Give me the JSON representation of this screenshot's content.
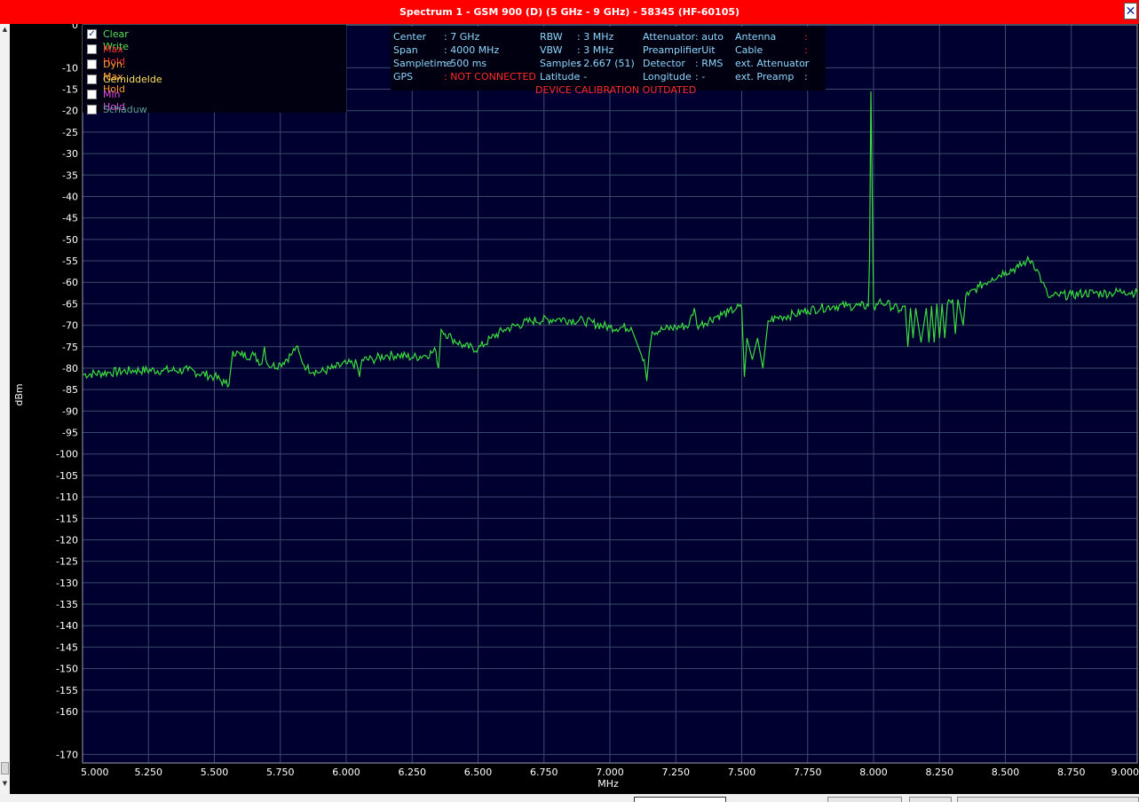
{
  "window": {
    "title": "Spectrum 1 - GSM 900 (D) (5 GHz - 9 GHz) - 58345 (HF-60105)",
    "close_glyph": "✕"
  },
  "colors": {
    "title_bar": "#ff0000",
    "plot_bg": "#000030",
    "grid": "#3a4a6a",
    "trace": "#3cdc3c",
    "axis_text": "#ffffff",
    "info_text": "#8fd7ff",
    "warning_text": "#ff2a2a"
  },
  "legend": [
    {
      "label": "Clear Write",
      "checked": true,
      "color": "#55e055"
    },
    {
      "label": "Max Hold",
      "checked": false,
      "color": "#ff3030"
    },
    {
      "label": "Dyn. Max Hold",
      "checked": false,
      "color": "#ff9a30"
    },
    {
      "label": "Gemiddelde",
      "checked": false,
      "color": "#ffe060"
    },
    {
      "label": "Min Hold",
      "checked": false,
      "color": "#e050e0"
    },
    {
      "label": "Schaduw",
      "checked": false,
      "color": "#5aa0a0"
    }
  ],
  "info": {
    "center_label": "Center",
    "center_value": ": 7 GHz",
    "span_label": "Span",
    "span_value": ": 4000 MHz",
    "sampletime_label": "Sampletime",
    "sampletime_value": ": 500 ms",
    "gps_label": "GPS",
    "gps_value": ": NOT CONNECTED",
    "rbw_label": "RBW",
    "rbw_value": ": 3 MHz",
    "vbw_label": "VBW",
    "vbw_value": ": 3 MHz",
    "samples_label": "Samples",
    "samples_value": ": 2.667 (51)",
    "latitude_label": "Latitude",
    "latitude_value": ": -",
    "attenuator_label": "Attenuator",
    "attenuator_value": ": auto",
    "preamp_label": "Preamplifier",
    "preamp_value": ": Uit",
    "detector_label": "Detector",
    "detector_value": ": RMS",
    "longitude_label": "Longitude",
    "longitude_value": ": -",
    "antenna_label": "Antenna",
    "antenna_value": ":",
    "cable_label": "Cable",
    "cable_value": ":",
    "ext_att_label": "ext. Attenuator",
    "ext_att_value": ":",
    "ext_preamp_label": "ext. Preamp",
    "ext_preamp_value": ":",
    "warning": "DEVICE CALIBRATION OUTDATED"
  },
  "chart_data": {
    "type": "line",
    "xlabel": "MHz",
    "ylabel": "dBm",
    "xlim": [
      5000,
      9000
    ],
    "ylim": [
      -172,
      0
    ],
    "grid": true,
    "x_ticks": [
      "5.000",
      "5.250",
      "5.500",
      "5.750",
      "6.000",
      "6.250",
      "6.500",
      "6.750",
      "7.000",
      "7.250",
      "7.500",
      "7.750",
      "8.000",
      "8.250",
      "8.500",
      "8.750",
      "9.000"
    ],
    "y_ticks": [
      "0",
      "-10",
      "-15",
      "-20",
      "-25",
      "-30",
      "-35",
      "-40",
      "-45",
      "-50",
      "-55",
      "-60",
      "-65",
      "-70",
      "-75",
      "-80",
      "-85",
      "-90",
      "-95",
      "-100",
      "-105",
      "-110",
      "-115",
      "-120",
      "-125",
      "-130",
      "-135",
      "-140",
      "-145",
      "-150",
      "-155",
      "-160",
      "-170"
    ],
    "series": [
      {
        "name": "Clear Write",
        "x": [
          5000,
          5100,
          5200,
          5300,
          5400,
          5500,
          5540,
          5555,
          5570,
          5600,
          5650,
          5680,
          5690,
          5700,
          5720,
          5750,
          5790,
          5810,
          5830,
          5850,
          5900,
          5950,
          6000,
          6040,
          6050,
          6060,
          6100,
          6150,
          6200,
          6250,
          6300,
          6340,
          6350,
          6360,
          6400,
          6450,
          6500,
          6550,
          6600,
          6700,
          6800,
          6900,
          7000,
          7080,
          7120,
          7130,
          7140,
          7150,
          7160,
          7200,
          7250,
          7300,
          7320,
          7330,
          7340,
          7400,
          7450,
          7480,
          7500,
          7510,
          7520,
          7540,
          7560,
          7580,
          7600,
          7650,
          7700,
          7750,
          7800,
          7850,
          7900,
          7950,
          7980,
          7985,
          7990,
          7995,
          8000,
          8005,
          8010,
          8020,
          8050,
          8100,
          8120,
          8130,
          8140,
          8150,
          8160,
          8180,
          8200,
          8210,
          8220,
          8230,
          8240,
          8250,
          8260,
          8270,
          8280,
          8300,
          8310,
          8320,
          8340,
          8350,
          8360,
          8400,
          8450,
          8500,
          8550,
          8580,
          8600,
          8620,
          8640,
          8660,
          8670,
          8700,
          8750,
          8800,
          8850,
          8900,
          8950,
          9000
        ],
        "y": [
          -81.5,
          -81,
          -80.5,
          -80.5,
          -80.5,
          -82,
          -83.5,
          -84,
          -76,
          -77,
          -77,
          -79,
          -75,
          -79,
          -79.5,
          -79,
          -77,
          -75,
          -78,
          -80,
          -81,
          -80,
          -79,
          -79,
          -82,
          -78,
          -78,
          -77,
          -77,
          -77.5,
          -77,
          -76,
          -80,
          -71,
          -73,
          -75,
          -75.5,
          -73,
          -71,
          -69,
          -68.5,
          -69,
          -70.5,
          -70.5,
          -77,
          -78,
          -83,
          -76,
          -71.5,
          -71,
          -70.5,
          -70,
          -66,
          -70,
          -70,
          -68,
          -67,
          -66,
          -66,
          -82,
          -73,
          -78,
          -73,
          -80,
          -69,
          -68,
          -67.5,
          -66.5,
          -66,
          -65.5,
          -65.5,
          -65.5,
          -65.5,
          -55,
          -15.5,
          -40,
          -65.5,
          -66.5,
          -65,
          -64.5,
          -65,
          -66.5,
          -65.5,
          -75,
          -66,
          -73,
          -66,
          -74,
          -66,
          -74,
          -65.5,
          -74,
          -65,
          -73,
          -65,
          -73,
          -65,
          -64,
          -72,
          -64,
          -70,
          -63,
          -63,
          -61,
          -59,
          -57.5,
          -56.5,
          -55,
          -55,
          -57,
          -60,
          -63,
          -63.5,
          -63,
          -63,
          -62.5,
          -62.5,
          -62.5,
          -62,
          -62.5
        ]
      }
    ]
  }
}
